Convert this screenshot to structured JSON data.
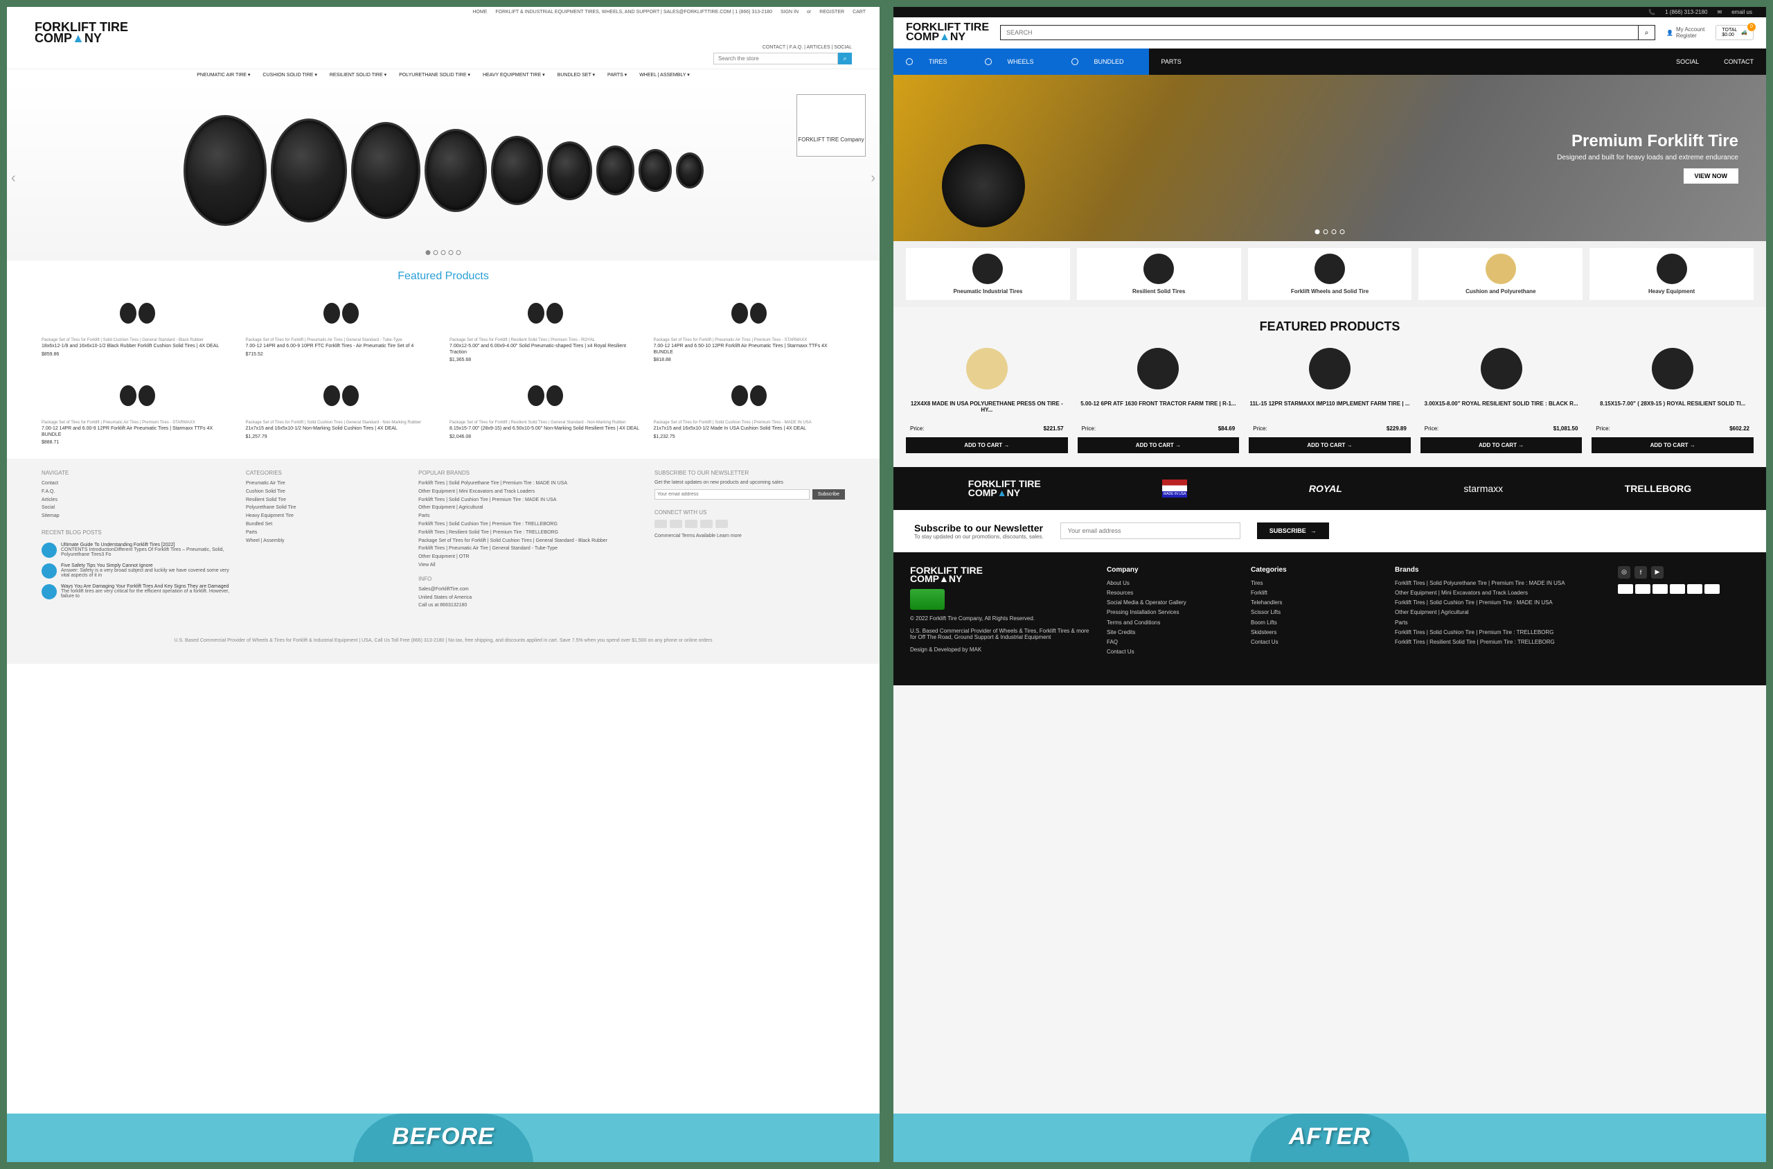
{
  "before": {
    "topbar": {
      "home": "HOME",
      "tagline": "FORKLIFT & INDUSTRIAL EQUIPMENT TIRES, WHEELS, AND SUPPORT | SALES@FORKLIFTTIRE.COM | 1 (866) 313-2180",
      "signin": "SIGN IN",
      "or": "or",
      "register": "REGISTER",
      "cart": "CART"
    },
    "logo1": "FORKLIFT TIRE",
    "logo2": "COMP",
    "logo3": "NY",
    "contact": "CONTACT | F.A.Q. | ARTICLES | SOCIAL",
    "search_ph": "Search the store",
    "nav": [
      "PNEUMATIC AIR TIRE ▾",
      "CUSHION SOLID TIRE ▾",
      "RESILIENT SOLID TIRE ▾",
      "POLYURETHANE SOLID TIRE ▾",
      "HEAVY EQUIPMENT TIRE ▾",
      "BUNDLED SET ▾",
      "PARTS ▾",
      "WHEEL | ASSEMBLY ▾"
    ],
    "hero_logo": "FORKLIFT TIRE Company",
    "featured": "Featured Products",
    "products": [
      {
        "cat": "Package Set of Tires for Forklift | Solid Cushion Tires | General Standard - Black Rubber",
        "name": "18x6x12-1/8 and 16x6x10-1/2 Black Rubber Forklift Cushion Solid Tires | 4X DEAL",
        "price": "$859.86"
      },
      {
        "cat": "Package Set of Tires for Forklift | Pneumatic Air Tires | General Standard - Tube-Type",
        "name": "7.00-12 14PR and 6.00-9 10PR FTC Forklift Tires - Air Pneumatic Tire Set of 4",
        "price": "$715.52"
      },
      {
        "cat": "Package Set of Tires for Forklift | Resilient Solid Tires | Premium Tires - ROYAL",
        "name": "7.00x12-5.00\" and 6.00x9-4.00\" Solid Pneumatic-shaped Tires | x4 Royal Resilient Traction",
        "price": "$1,365.68"
      },
      {
        "cat": "Package Set of Tires for Forklift | Pneumatic Air Tires | Premium Tires - STARMAXX",
        "name": "7.00-12 14PR and 6.50-10 12PR Forklift Air Pneumatic Tires | Starmaxx TTFs 4X BUNDLE",
        "price": "$818.88"
      },
      {
        "cat": "Package Set of Tires for Forklift | Pneumatic Air Tires | Premium Tires - STARMAXX",
        "name": "7.00-12 14PR and 6.00-9 12PR Forklift Air Pneumatic Tires | Starmaxx TTFs 4X BUNDLE",
        "price": "$888.71"
      },
      {
        "cat": "Package Set of Tires for Forklift | Solid Cushion Tires | General Standard - Non-Marking Rubber",
        "name": "21x7x15 and 16x5x10-1/2 Non-Marking Solid Cushion Tires | 4X DEAL",
        "price": "$1,257.79"
      },
      {
        "cat": "Package Set of Tires for Forklift | Resilient Solid Tires | General Standard - Non-Marking Rubber",
        "name": "8.15x15-7.00\" (28x9-15) and 6.50x10-5.00\" Non-Marking Solid Resilient Tires | 4X DEAL",
        "price": "$2,046.08"
      },
      {
        "cat": "Package Set of Tires for Forklift | Solid Cushion Tires | Premium Tires - MADE IN USA",
        "name": "21x7x15 and 16x5x10-1/2 Made In USA Cushion Solid Tires | 4X DEAL",
        "price": "$1,232.75"
      }
    ],
    "footer": {
      "nav_h": "NAVIGATE",
      "nav": [
        "Contact",
        "F.A.Q.",
        "Articles",
        "Social",
        "Sitemap"
      ],
      "cat_h": "CATEGORIES",
      "cat": [
        "Pneumatic Air Tire",
        "Cushion Solid Tire",
        "Resilient Solid Tire",
        "Polyurethane Solid Tire",
        "Heavy Equipment Tire",
        "Bundled Set",
        "Parts",
        "Wheel | Assembly"
      ],
      "brand_h": "POPULAR BRANDS",
      "brand": [
        "Forklift Tires | Solid Polyurethane Tire | Premium Tire : MADE IN USA",
        "Other Equipment | Mini Excavators and Track Loaders",
        "Forklift Tires | Solid Cushion Tire | Premium Tire : MADE IN USA",
        "Other Equipment | Agricultural",
        "Parts",
        "Forklift Tires | Solid Cushion Tire | Premium Tire : TRELLEBORG",
        "Forklift Tires | Resilient Solid Tire | Premium Tire : TRELLEBORG",
        "Package Set of Tires for Forklift | Solid Cushion Tires | General Standard - Black Rubber",
        "Forklift Tires | Pneumatic Air Tire | General Standard - Tube-Type",
        "Other Equipment | OTR",
        "View All"
      ],
      "sub_h": "SUBSCRIBE TO OUR NEWSLETTER",
      "sub_txt": "Get the latest updates on new products and upcoming sales",
      "sub_ph": "Your email address",
      "sub_btn": "Subscribe",
      "conn_h": "CONNECT WITH US",
      "terms": "Commercial Terms Available Learn more",
      "blog_h": "RECENT BLOG POSTS",
      "blog": [
        {
          "t": "Ultimate Guide To Understanding Forklift Tires [2022]",
          "d": "CONTENTS IntroductionDifferent Types Of Forklift Tires – Pneumatic, Solid, Polyurethane Tires3 Fo"
        },
        {
          "t": "Five Safety Tips You Simply Cannot Ignore",
          "d": "Answer: Safety is a very broad subject and luckily we have covered some very vital aspects of it in"
        },
        {
          "t": "Ways You Are Damaging Your Forklift Tires And Key Signs They are Damaged",
          "d": "The forklift tires are very critical for the efficient operation of a forklift. However, failure to"
        }
      ],
      "info_h": "INFO",
      "info": [
        "Sales@ForkliftTire.com",
        "United States of America",
        "Call us at 8663132180"
      ],
      "foot": "U.S. Based Commercial Provider of Wheels & Tires for Forklift & Industrial Equipment | USA, Call Us Toll Free (866) 313-2180 | No tax, free shipping, and discounts applied in cart. Save 7.5% when you spend over $1,500 on any phone or online orders"
    }
  },
  "after": {
    "topbar": {
      "phone": "1 (866) 313-2180",
      "email": "email us"
    },
    "logo1": "FORKLIFT TIRE",
    "logo2": "COMP",
    "logo3": "NY",
    "search_ph": "SEARCH",
    "acct": "My Account",
    "reg": "Register",
    "cart_l": "TOTAL",
    "cart_v": "$0.00",
    "cart_n": "0",
    "nav": {
      "tires": "TIRES",
      "wheels": "WHEELS",
      "bundled": "BUNDLED",
      "parts": "PARTS",
      "social": "SOCIAL",
      "contact": "CONTACT"
    },
    "hero": {
      "h": "Premium Forklift Tire",
      "p": "Designed and built for heavy loads and extreme endurance",
      "btn": "VIEW NOW"
    },
    "cats": [
      "Pneumatic Industrial Tires",
      "Resilient Solid Tires",
      "Forklift Wheels and Solid Tire",
      "Cushion and Polyurethane",
      "Heavy Equipment"
    ],
    "featured": "FEATURED PRODUCTS",
    "price_l": "Price:",
    "add": "ADD TO CART",
    "products": [
      {
        "name": "12X4X8 MADE IN USA POLYURETHANE PRESS ON TIRE - HY...",
        "price": "$221.57"
      },
      {
        "name": "5.00-12 6PR ATF 1630 FRONT TRACTOR FARM TIRE | R-1...",
        "price": "$84.69"
      },
      {
        "name": "11L-15 12PR STARMAXX IMP110 IMPLEMENT FARM TIRE | ...",
        "price": "$229.89"
      },
      {
        "name": "3.00X15-8.00\" ROYAL RESILIENT SOLID TIRE : BLACK R...",
        "price": "$1,081.50"
      },
      {
        "name": "8.15X15-7.00\" ( 28X9-15 ) ROYAL RESILIENT SOLID TI...",
        "price": "$602.22"
      }
    ],
    "brands": [
      "ROYAL",
      "starmaxx",
      "TRELLEBORG"
    ],
    "flag": "MADE IN USA",
    "news": {
      "h": "Subscribe to our Newsletter",
      "p": "To stay updated on our promotions, discounts, sales.",
      "ph": "Your email address",
      "btn": "SUBSCRIBE"
    },
    "footer": {
      "copy": "© 2022 Forklift Tire Company, All Rights Reserved.",
      "desc": "U.S. Based Commercial Provider of Wheels & Tires, Forklift Tires & more for Off The Road, Ground Support & Industrial Equipment",
      "dev": "Design & Developed by MAK",
      "comp_h": "Company",
      "comp": [
        "About Us",
        "Resources",
        "Social Media & Operator Gallery",
        "Pressing Installation Services",
        "Terms and Conditions",
        "Site Credits",
        "FAQ",
        "Contact Us"
      ],
      "cat_h": "Categories",
      "cat": [
        "Tires",
        "Forklift",
        "Telehandlers",
        "Scissor Lifts",
        "Boom Lifts",
        "Skidsteers",
        "Contact Us"
      ],
      "brand_h": "Brands",
      "brand": [
        "Forklift Tires | Solid Polyurethane Tire | Premium Tire : MADE IN USA",
        "Other Equipment | Mini Excavators and Track Loaders",
        "Forklift Tires | Solid Cushion Tire | Premium Tire : MADE IN USA",
        "Other Equipment | Agricultural",
        "Parts",
        "Forklift Tires | Solid Cushion Tire | Premium Tire : TRELLEBORG",
        "Forklift Tires | Resilient Solid Tire | Premium Tire : TRELLEBORG"
      ]
    }
  },
  "ribbon": {
    "before": "BEFORE",
    "after": "AFTER"
  }
}
